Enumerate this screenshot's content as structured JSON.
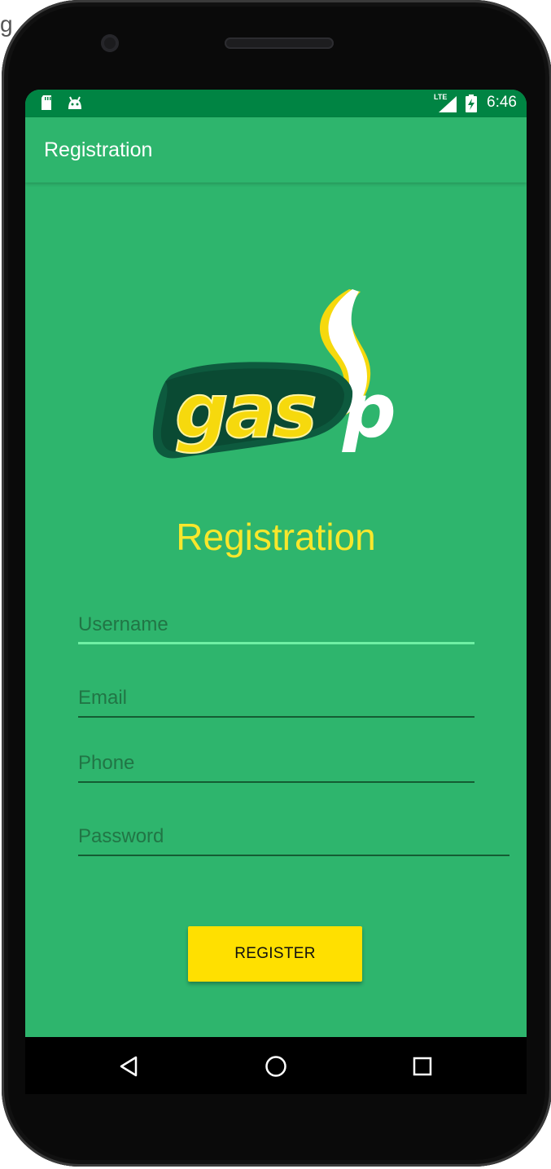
{
  "background": {
    "partial_text": "g"
  },
  "status_bar": {
    "time": "6:46",
    "network_label": "LTE",
    "icons": [
      "sd-card-icon",
      "android-icon",
      "signal-icon",
      "battery-charging-icon"
    ],
    "color": "#008443"
  },
  "app_bar": {
    "title": "Registration",
    "color": "#2eb56d"
  },
  "logo": {
    "text": "gasp",
    "colors": {
      "yellow": "#f6d90d",
      "dark_green": "#0d5a3e",
      "white": "#ffffff"
    }
  },
  "form": {
    "heading": "Registration",
    "heading_color": "#f8e72c",
    "fields": {
      "username": {
        "placeholder": "Username",
        "value": ""
      },
      "email": {
        "placeholder": "Email",
        "value": ""
      },
      "phone": {
        "placeholder": "Phone",
        "value": ""
      },
      "password": {
        "placeholder": "Password",
        "value": ""
      }
    },
    "register_label": "REGISTER",
    "register_color": "#ffe000"
  },
  "nav_bar": {
    "icons": [
      "back-icon",
      "home-icon",
      "recents-icon"
    ]
  }
}
